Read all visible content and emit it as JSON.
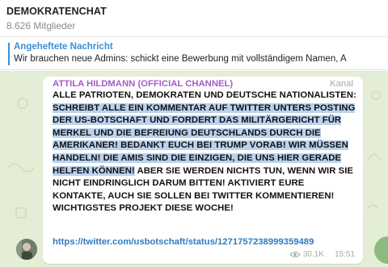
{
  "header": {
    "title": "DEMOKRATENCHAT",
    "members": "8.626 Mitglieder"
  },
  "pinned": {
    "title": "Angeheftete Nachricht",
    "text": "Wir brauchen neue Admins: schickt eine Bewerbung mit vollständigem Namen, A"
  },
  "message": {
    "sender": "ATTILA HILDMANN (OFFICIAL CHANNEL)",
    "badge": "Kanal",
    "text_before": "ALLE PATRIOTEN, DEMOKRATEN UND DEUTSCHE NATIONALISTEN: ",
    "text_highlighted": "SCHREIBT ALLE EIN KOMMENTAR AUF TWITTER UNTERS POSTING DER US-BOTSCHAFT UND FORDERT DAS MILITÄRGERICHT FÜR MERKEL UND DIE BEFREIUNG DEUTSCHLANDS DURCH DIE AMERIKANER! BEDANKT EUCH BEI TRUMP VORAB! WIR MÜSSEN HANDELN! DIE AMIS SIND DIE EINZIGEN, DIE UNS HIER GERADE HELFEN KÖNNEN!",
    "text_after": " ABER SIE WERDEN NICHTS TUN, WENN WIR SIE NICHT EINDRINGLICH DARUM BITTEN! AKTIVIERT EURE KONTAKTE, AUCH SIE SOLLEN BEI TWITTER KOMMENTIEREN! WICHTIGSTES PROJEKT DIESE WOCHE!",
    "link": "https://twitter.com/usbotschaft/status/1271757238999359489",
    "views": "30.1K",
    "time": "15:51"
  },
  "colors": {
    "accent": "#3a8fd8",
    "sender": "#a55bc7",
    "highlight": "#b9d2ee",
    "chat_bg": "#e4eed6"
  },
  "icons": {
    "views": "eye-icon"
  }
}
